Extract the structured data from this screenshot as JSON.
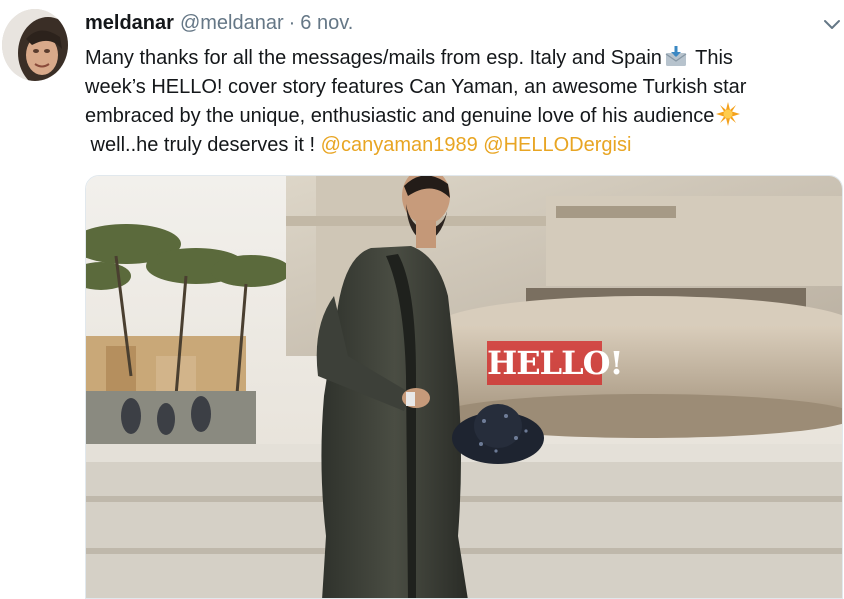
{
  "tweet": {
    "author_name": "meldanar",
    "author_handle": "@meldanar",
    "separator": "·",
    "date": "6 nov.",
    "lines": [
      {
        "before": "Many thanks for all the messages/mails from esp. Italy and Spain",
        "emoji": "incoming-envelope-icon",
        "after": " This"
      },
      {
        "text": "week’s HELLO! cover story features Can Yaman, an awesome Turkish star"
      },
      {
        "before": "embraced by the unique, enthusiastic and genuine love of his audience",
        "emoji": "glowing-star-icon",
        "after": ""
      },
      {
        "before": " well..he truly deserves it ! ",
        "mention1": "@canyaman1989",
        "mention2": "@HELLODergisi"
      }
    ],
    "mention_color": "#e8a523",
    "text_color": "#14171a",
    "meta_color": "#657786"
  },
  "media": {
    "watermark": "HELLO!"
  },
  "icons": {
    "caret": "chevron-down-icon",
    "envelope": "incoming-envelope-icon",
    "star": "glowing-star-icon"
  }
}
